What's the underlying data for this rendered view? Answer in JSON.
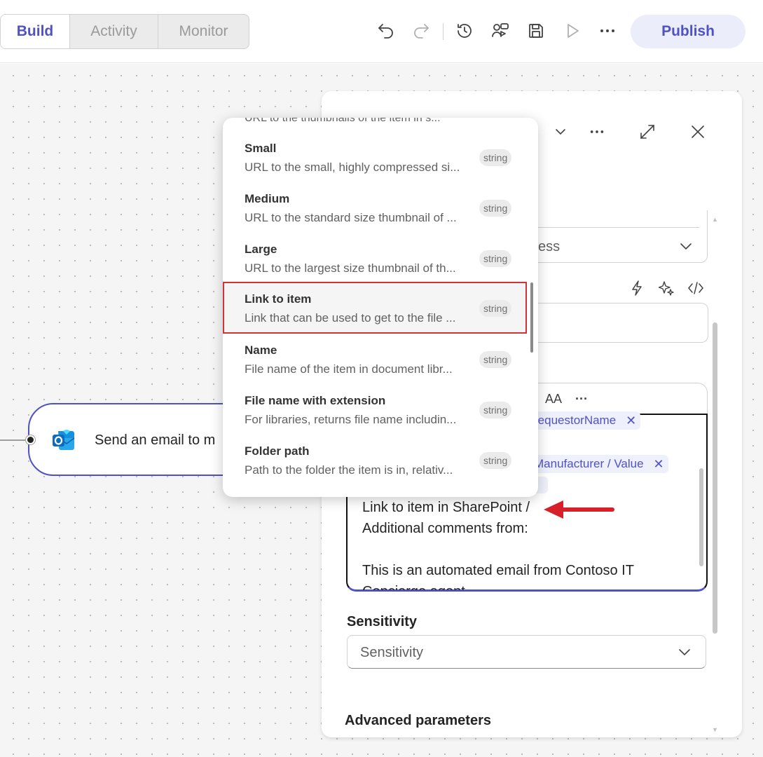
{
  "tabs": [
    {
      "label": "Build",
      "active": true
    },
    {
      "label": "Activity",
      "active": false
    },
    {
      "label": "Monitor",
      "active": false
    }
  ],
  "toolbar": {
    "icons": [
      "undo-icon",
      "redo-icon",
      "history-icon",
      "test-flow-icon",
      "save-icon",
      "run-icon",
      "more-icon"
    ],
    "publish_label": "Publish"
  },
  "node": {
    "label": "Send an email to m",
    "icon": "outlook-icon"
  },
  "panel": {
    "header_icons": [
      "chevron-down-icon",
      "more-icon",
      "expand-icon",
      "close-icon"
    ],
    "field1_text": "ess",
    "field_action_icons": [
      "lightning-icon",
      "sparkle-icon",
      "code-icon"
    ],
    "editor_toolbar": {
      "font_size_label": "AA",
      "more": "···"
    },
    "editor": {
      "token1": "requestorName",
      "token2": "Manufacturer / Value",
      "line1": "Link to item in SharePoint /",
      "line2": "Additional comments from:",
      "line3": "This is an automated email from Contoso IT",
      "line4": "Concierge agent"
    },
    "sensitivity_label": "Sensitivity",
    "sensitivity_placeholder": "Sensitivity",
    "advanced_label": "Advanced parameters"
  },
  "dropdown": {
    "cut_off_text": "URL to the thumbnails of the item in s...",
    "items": [
      {
        "title": "Small",
        "desc": "URL to the small, highly compressed si...",
        "type": "string"
      },
      {
        "title": "Medium",
        "desc": "URL to the standard size thumbnail of ...",
        "type": "string"
      },
      {
        "title": "Large",
        "desc": "URL to the largest size thumbnail of th...",
        "type": "string"
      },
      {
        "title": "Link to item",
        "desc": "Link that can be used to get to the file ...",
        "type": "string",
        "selected": true
      },
      {
        "title": "Name",
        "desc": "File name of the item in document libr...",
        "type": "string"
      },
      {
        "title": "File name with extension",
        "desc": "For libraries, returns file name includin...",
        "type": "string"
      },
      {
        "title": "Folder path",
        "desc": "Path to the folder the item is in, relativ...",
        "type": "string"
      }
    ]
  },
  "colors": {
    "accent": "#4f52c4",
    "highlight": "#d13438"
  }
}
